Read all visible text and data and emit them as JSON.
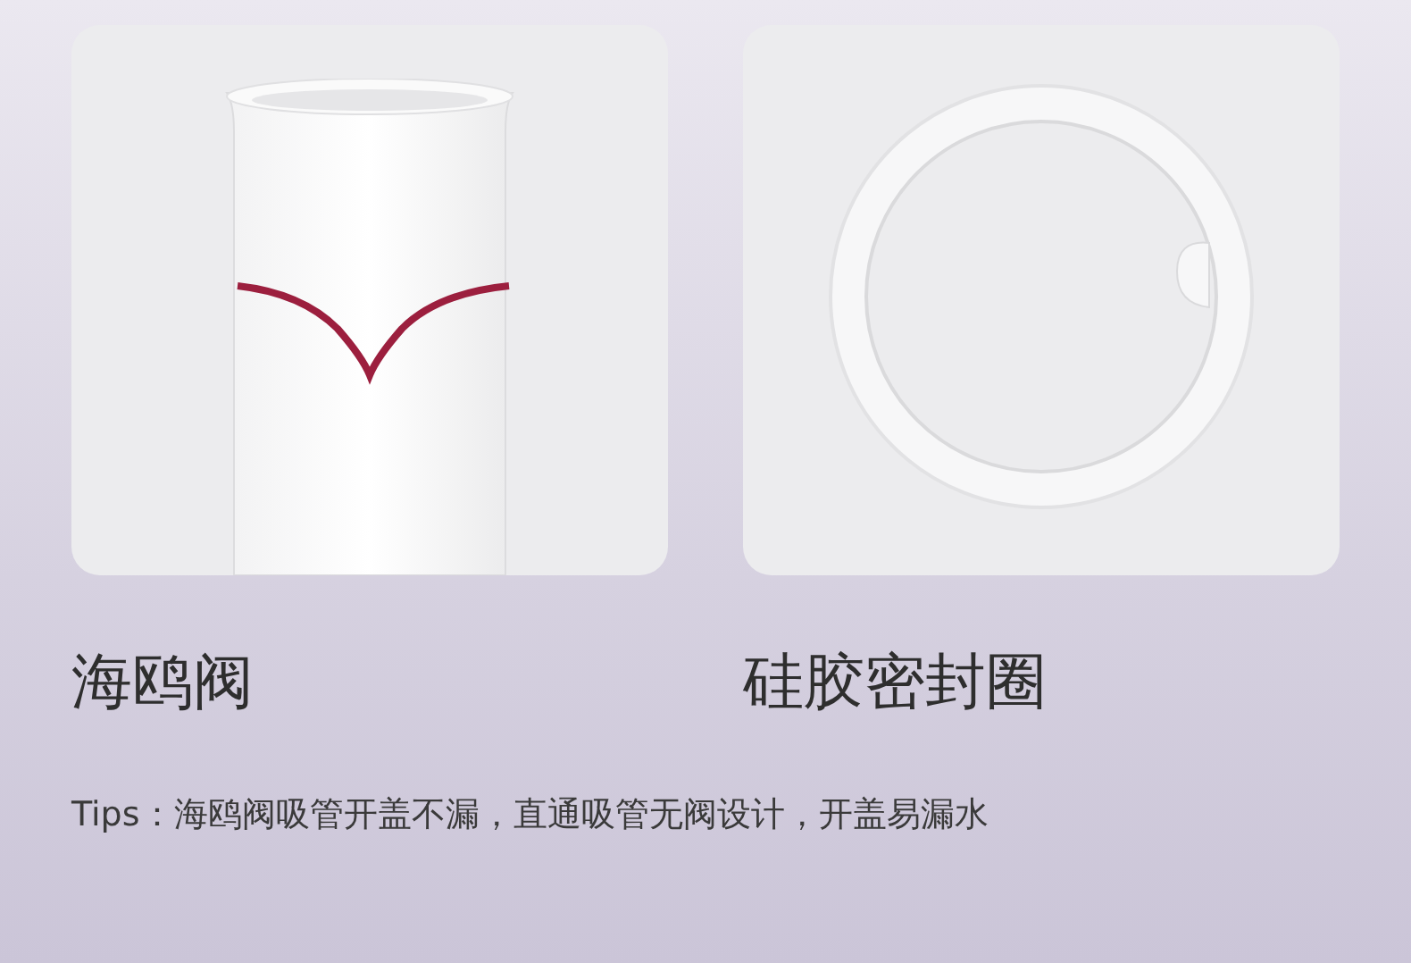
{
  "panels": [
    {
      "kind": "valve",
      "caption": "海鸥阀"
    },
    {
      "kind": "seal-ring",
      "caption": "硅胶密封圈"
    }
  ],
  "tips": "Tips：海鸥阀吸管开盖不漏，直通吸管无阀设计，开盖易漏水"
}
